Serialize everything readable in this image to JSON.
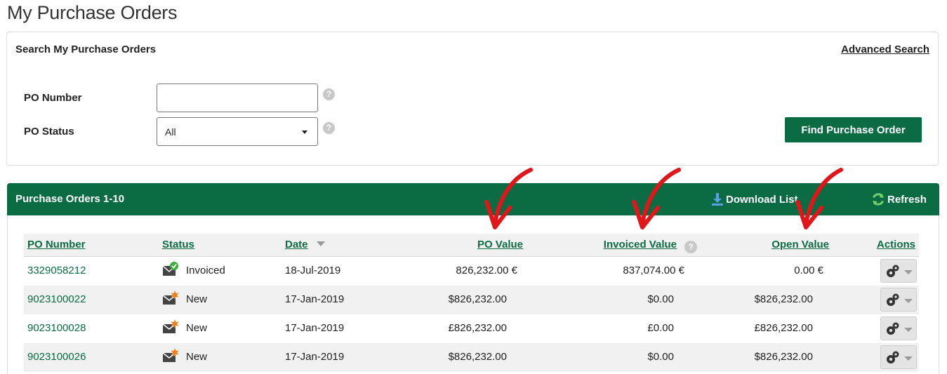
{
  "page_title": "My Purchase Orders",
  "search": {
    "title": "Search My Purchase Orders",
    "advanced_link": "Advanced Search",
    "po_number_label": "PO Number",
    "po_number_value": "",
    "po_status_label": "PO Status",
    "po_status_value": "All",
    "help_icon": "question-circle-icon",
    "find_button": "Find Purchase Order"
  },
  "results": {
    "title": "Purchase Orders 1-10",
    "download_label": "Download List",
    "refresh_label": "Refresh",
    "columns": {
      "po_number": "PO Number",
      "status": "Status",
      "date": "Date",
      "po_value": "PO Value",
      "invoiced_value": "Invoiced Value",
      "open_value": "Open Value",
      "actions": "Actions"
    },
    "rows": [
      {
        "po_number": "3329058212",
        "status": "Invoiced",
        "status_icon": "envelope-check-icon",
        "date": "18-Jul-2019",
        "po_value": "826,232.00 €",
        "invoiced_value": "837,074.00 €",
        "open_value": "0.00 €"
      },
      {
        "po_number": "9023100022",
        "status": "New",
        "status_icon": "envelope-new-icon",
        "date": "17-Jan-2019",
        "po_value": "$826,232.00",
        "invoiced_value": "$0.00",
        "open_value": "$826,232.00"
      },
      {
        "po_number": "9023100028",
        "status": "New",
        "status_icon": "envelope-new-icon",
        "date": "17-Jan-2019",
        "po_value": "£826,232.00",
        "invoiced_value": "£0.00",
        "open_value": "£826,232.00"
      },
      {
        "po_number": "9023100026",
        "status": "New",
        "status_icon": "envelope-new-icon",
        "date": "17-Jan-2019",
        "po_value": "$826,232.00",
        "invoiced_value": "$0.00",
        "open_value": "$826,232.00"
      }
    ]
  },
  "colors": {
    "brand_green": "#0b6b43",
    "annotation_red": "#e0161b"
  }
}
